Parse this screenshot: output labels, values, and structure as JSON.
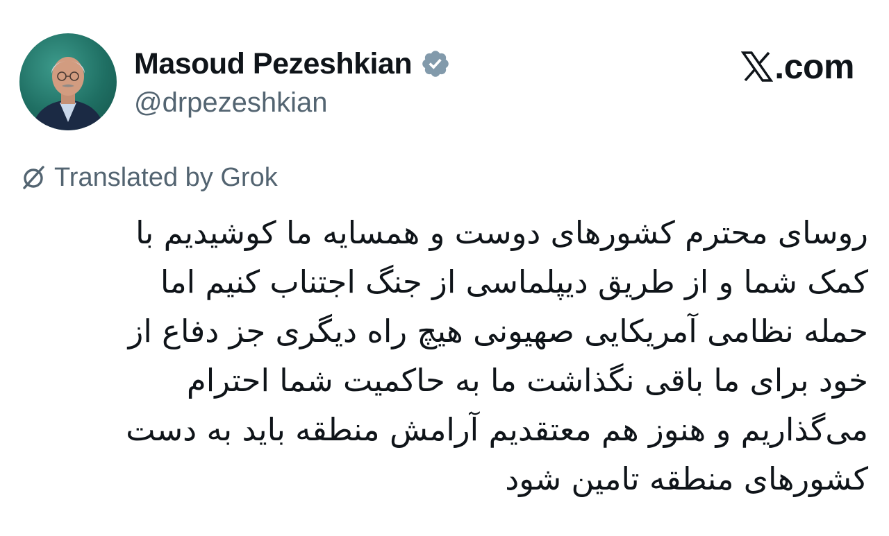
{
  "author": {
    "name": "Masoud Pezeshkian",
    "handle": "@drpezeshkian",
    "verified_icon": "verified-badge-icon"
  },
  "brand": {
    "text": ".com",
    "logo": "x-logo-icon"
  },
  "translation": {
    "label": "Translated by Grok",
    "icon": "grok-icon"
  },
  "tweet": {
    "lines": [
      "روسای محترم کشورهای دوست و همسایه ما کوشیدیم با",
      "کمک شما و از طریق دیپلماسی از جنگ اجتناب کنیم اما",
      "حمله نظامی آمریکایی صهیونی هیچ راه دیگری جز دفاع از",
      "خود برای ما باقی نگذاشت ما به حاکمیت شما احترام",
      "می‌گذاریم و هنوز هم معتقدیم آرامش منطقه باید به دست",
      "کشورهای منطقه تامین شود"
    ]
  },
  "colors": {
    "text_primary": "#0f1419",
    "text_secondary": "#536471",
    "badge_gray": "#829aab",
    "avatar_bg": "#1f6f63"
  }
}
